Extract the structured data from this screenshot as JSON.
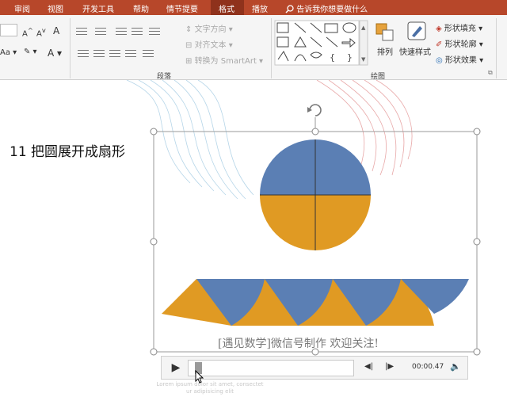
{
  "tabs": {
    "review": "审阅",
    "view": "视图",
    "developer": "开发工具",
    "help": "帮助",
    "storyboard": "情节提要",
    "format": "格式",
    "playback": "播放",
    "tell_me": "告诉我你想要做什么"
  },
  "ribbon": {
    "text_direction": "文字方向",
    "align_text": "对齐文本",
    "convert_smartart": "转换为 SmartArt",
    "arrange": "排列",
    "quick_styles": "快速样式",
    "shape_fill": "形状填充",
    "shape_outline": "形状轮廓",
    "shape_effects": "形状效果",
    "group_paragraph": "段落",
    "group_drawing": "绘图"
  },
  "slide": {
    "title": "11 把圆展开成扇形",
    "caption": "[遇见数学]微信号制作   欢迎关注!",
    "ghost_line1": "Lorem ipsum dolor sit amet, consectet",
    "ghost_line2": "ur adipisicing elit"
  },
  "player": {
    "play_glyph": "▶",
    "back_glyph": "◀|",
    "forward_glyph": "|▶",
    "time": "00:00.47",
    "volume_glyph": "🔈"
  },
  "colors": {
    "blue": "#5b7fb4",
    "orange": "#e09a23",
    "tab_bar": "#b7472a",
    "tab_active": "#8f321c"
  },
  "playback_progress": 0.03
}
